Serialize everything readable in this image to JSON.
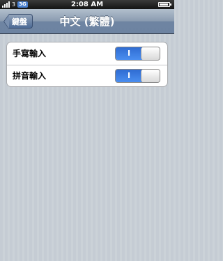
{
  "status": {
    "carrier": "3",
    "network": "3G",
    "time": "2:08 AM",
    "battery_icon": "battery-icon",
    "signal_icon": "signal-bars-icon"
  },
  "nav": {
    "back_label": "鍵盤",
    "title": "中文 (繁體)"
  },
  "settings": {
    "rows": [
      {
        "label": "手寫輸入",
        "toggle_on_text": "I",
        "state": "on"
      },
      {
        "label": "拼音輸入",
        "toggle_on_text": "I",
        "state": "on"
      }
    ]
  },
  "colors": {
    "nav_bar": "#6d83a1",
    "toggle_on": "#3a7be0",
    "background": "#c5ccd4"
  }
}
